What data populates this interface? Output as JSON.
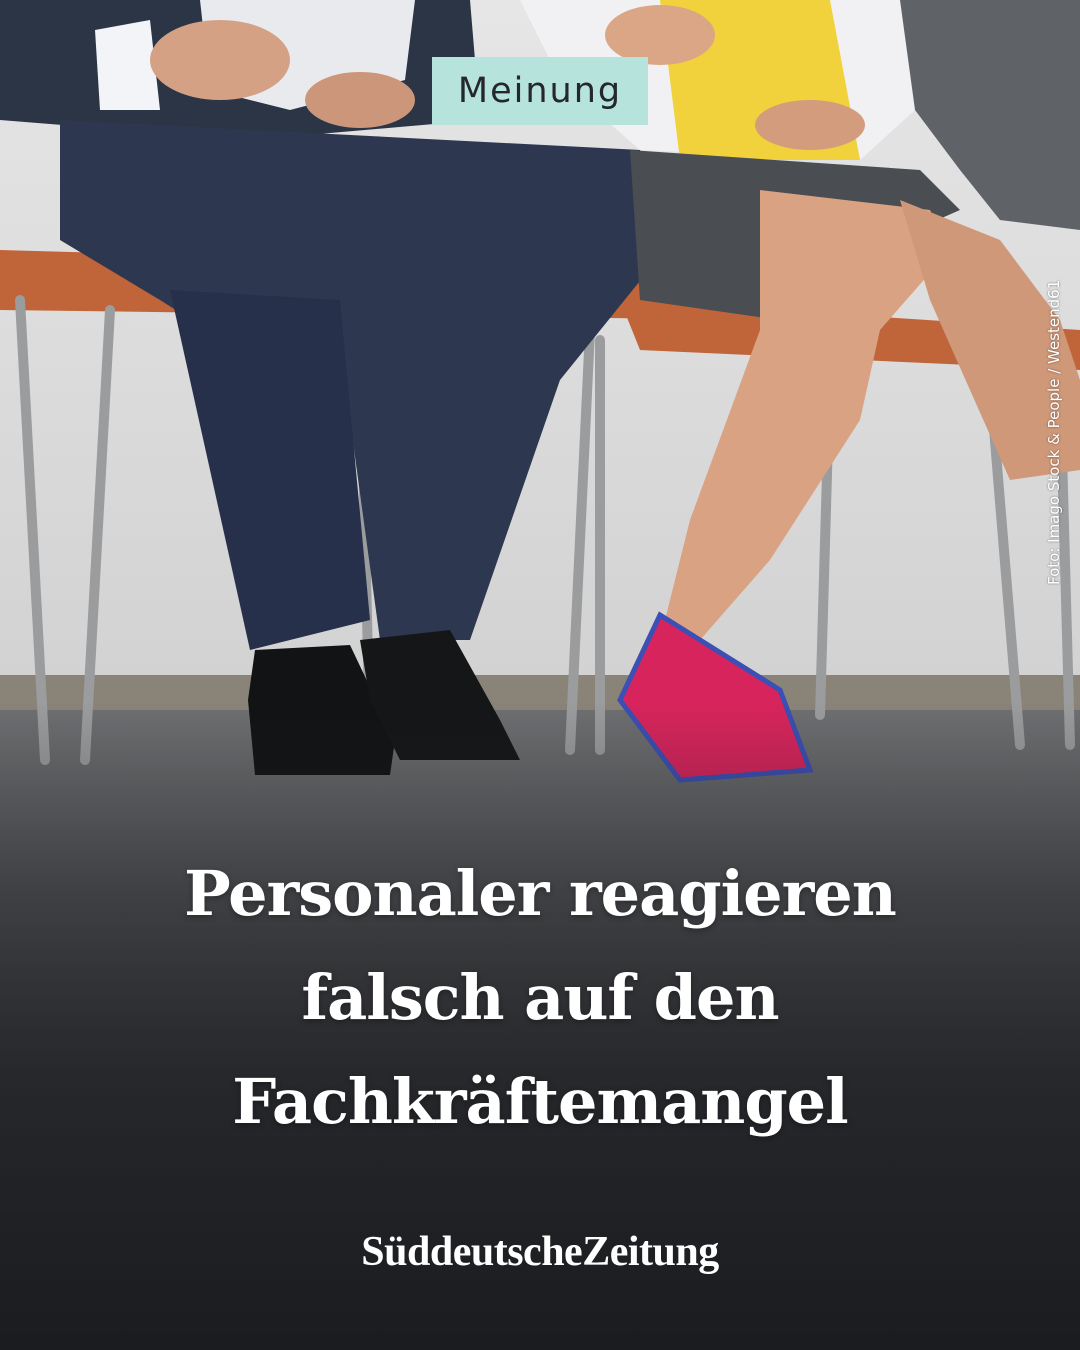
{
  "badge": {
    "label": "Meinung"
  },
  "photo_credit": "Foto: Imago Stock & People / Westend61",
  "headline": {
    "lines": [
      "Personaler reagieren",
      "falsch auf den",
      "Fachkräftemangel"
    ]
  },
  "brand": {
    "name": "SüddeutscheZeitung"
  },
  "colors": {
    "badge_bg": "#b6e3dc",
    "headline": "#ffffff",
    "background_dark": "#2a2c2f"
  }
}
